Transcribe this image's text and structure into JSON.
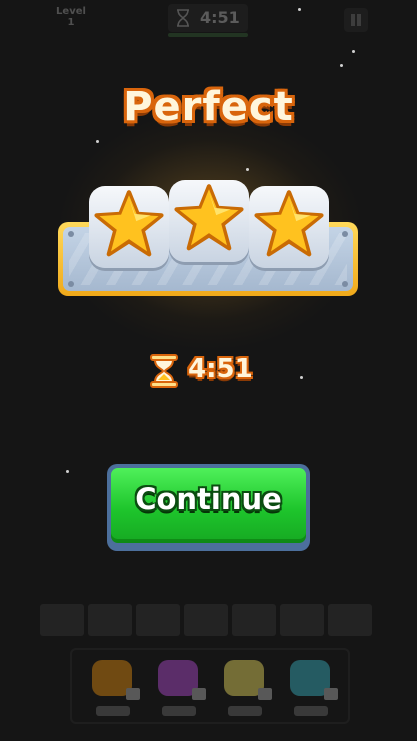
{
  "hud": {
    "level_label": "Level",
    "level_number": "1",
    "timer": "4:51"
  },
  "result": {
    "title": "Perfect",
    "stars_earned": 3,
    "stars_total": 3,
    "time": "4:51"
  },
  "continue_label": "Continue",
  "colors": {
    "star": "#ffc21f",
    "button": "#24c830",
    "title_outline": "#d9650c",
    "plate_frame": "#f0a91a"
  },
  "tools": [
    {
      "icon": "brush-icon"
    },
    {
      "icon": "books-icon"
    },
    {
      "icon": "magnet-icon"
    },
    {
      "icon": "hammer-icon"
    }
  ]
}
